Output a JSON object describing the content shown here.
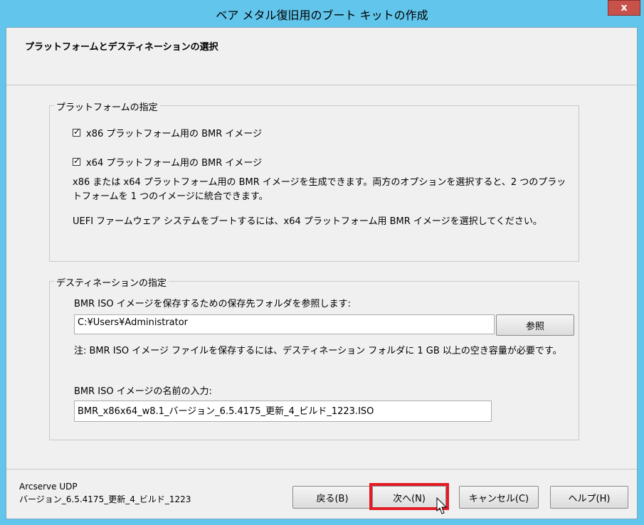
{
  "window": {
    "title": "ベア メタル復旧用のブート キットの作成",
    "close_glyph": "x"
  },
  "header": {
    "title": "プラットフォームとデスティネーションの選択"
  },
  "platform_group": {
    "legend": "プラットフォームの指定",
    "options": [
      {
        "label": "x86 プラットフォーム用の BMR イメージ",
        "checked": true
      },
      {
        "label": "x64 プラットフォーム用の BMR イメージ",
        "checked": true
      }
    ],
    "description_1": "x86 または x64 プラットフォーム用の BMR イメージを生成できます。両方のオプションを選択すると、2 つのプラットフォームを 1 つのイメージに統合できます。",
    "description_2": "UEFI ファームウェア システムをブートするには、x64 プラットフォーム用 BMR イメージを選択してください。"
  },
  "destination_group": {
    "legend": "デスティネーションの指定",
    "folder_label": "BMR ISO イメージを保存するための保存先フォルダを参照します:",
    "folder_value": "C:¥Users¥Administrator",
    "browse_label": "参照",
    "note": "注: BMR ISO イメージ ファイルを保存するには、デスティネーション フォルダに 1 GB 以上の空き容量が必要です。",
    "name_label": "BMR ISO イメージの名前の入力:",
    "name_value": "BMR_x86x64_w8.1_バージョン_6.5.4175_更新_4_ビルド_1223.ISO"
  },
  "footer": {
    "product": "Arcserve UDP",
    "version": "バージョン_6.5.4175_更新_4_ビルド_1223",
    "buttons": {
      "back": "戻る(B)",
      "next": "次へ(N)",
      "cancel": "キャンセル(C)",
      "help": "ヘルプ(H)"
    }
  },
  "colors": {
    "titlebar": "#62c5ec",
    "highlight": "#e21b25",
    "close": "#c7514b"
  }
}
